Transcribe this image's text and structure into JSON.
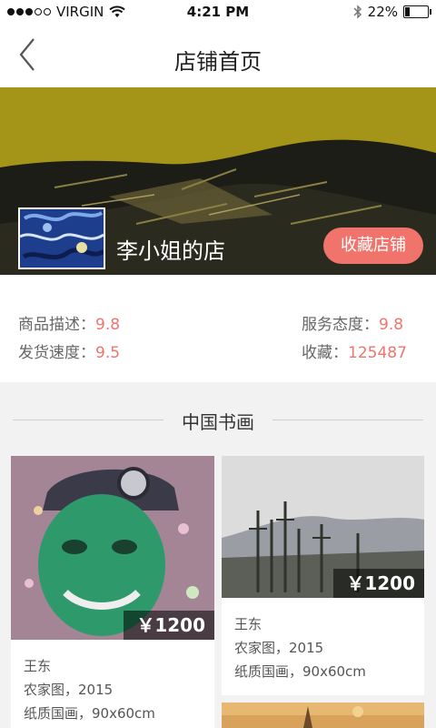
{
  "status_bar": {
    "carrier": "VIRGIN",
    "time": "4:21 PM",
    "battery": "22%",
    "battery_level": 0.22
  },
  "nav": {
    "title": "店铺首页"
  },
  "shop": {
    "name": "李小姐的店",
    "favorite_button": "收藏店铺"
  },
  "stats": {
    "desc_label": "商品描述：",
    "desc_value": "9.8",
    "service_label": "服务态度：",
    "service_value": "9.8",
    "ship_label": "发货速度：",
    "ship_value": "9.5",
    "fav_label": "收藏：",
    "fav_value": "125487"
  },
  "section": {
    "title": "中国书画"
  },
  "products": [
    {
      "price": "￥1200",
      "artist": "王东",
      "title": "农家图，2015",
      "spec": "纸质国画，90x60cm"
    },
    {
      "price": "￥1200",
      "artist": "王东",
      "title": "农家图，2015",
      "spec": "纸质国画，90x60cm"
    }
  ]
}
